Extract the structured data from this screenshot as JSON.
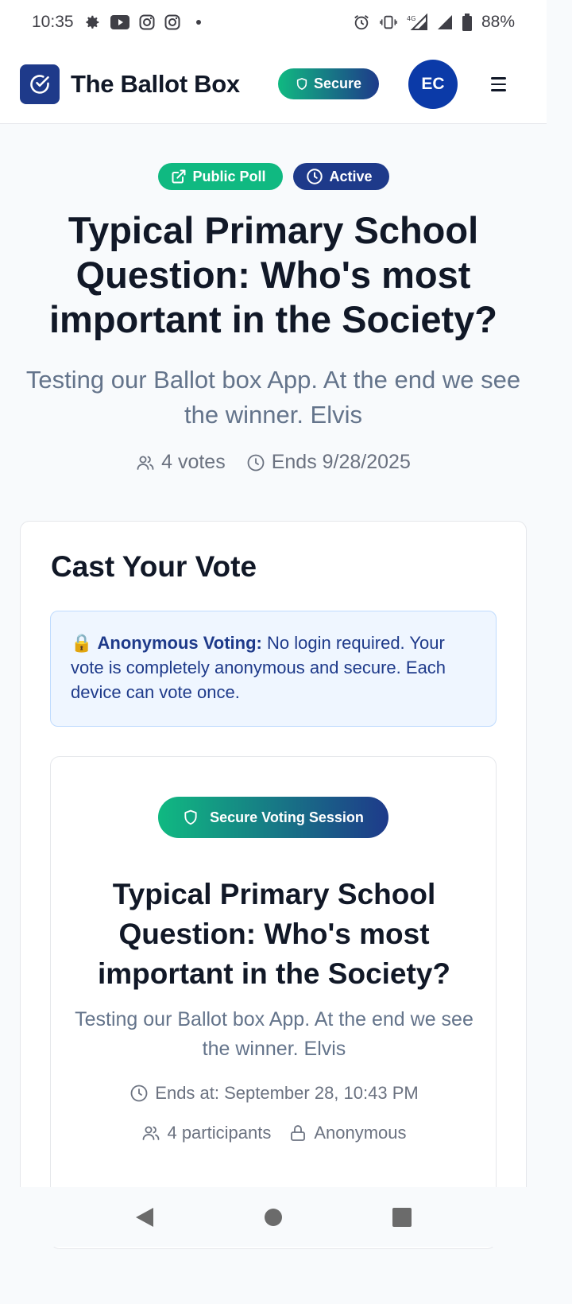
{
  "status_bar": {
    "time": "10:35",
    "battery": "88%",
    "network": "4G"
  },
  "header": {
    "app_title": "The Ballot Box",
    "secure_label": "Secure",
    "avatar_initials": "EC"
  },
  "poll": {
    "badges": {
      "public": "Public Poll",
      "active": "Active"
    },
    "title": "Typical Primary School Question: Who's most important in the Society?",
    "description": "Testing our Ballot box App. At the end we see the winner. Elvis",
    "votes": "4 votes",
    "ends": "Ends 9/28/2025"
  },
  "vote_card": {
    "title": "Cast Your Vote",
    "info_label": "Anonymous Voting:",
    "info_text": " No login required. Your vote is completely anonymous and secure. Each device can vote once.",
    "session_label": "Secure Voting Session",
    "inner_title": "Typical Primary School Question: Who's most important in the Society?",
    "inner_description": "Testing our Ballot box App. At the end we see the winner. Elvis",
    "ends_at": "Ends at: September 28, 10:43 PM",
    "participants": "4 participants",
    "privacy": "Anonymous"
  },
  "colors": {
    "brand_blue": "#1e3a8a",
    "brand_green": "#10b981",
    "info_bg": "#eff6ff"
  }
}
